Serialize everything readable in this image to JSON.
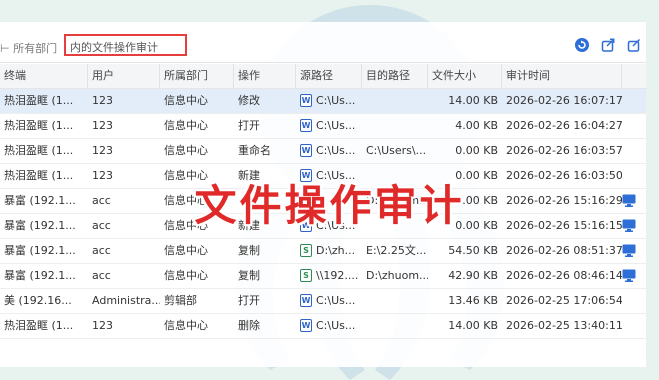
{
  "toolbar": {
    "breadcrumb": "⊢ 所有部门",
    "search_value": "内的文件操作审计",
    "refresh_icon": "refresh-icon",
    "export_icon": "export-icon",
    "share_icon": "share-icon"
  },
  "columns": [
    "终端",
    "用户",
    "所属部门",
    "操作",
    "源路径",
    "目的路径",
    "文件大小",
    "审计时间",
    ""
  ],
  "rows": [
    {
      "terminal": "热泪盈眶 (1...",
      "user": "123",
      "dept": "信息中心",
      "op": "修改",
      "src": "C:\\Us...",
      "dst": "",
      "size": "14.00 KB",
      "time": "2026-02-26 16:07:17",
      "icon": "word",
      "monitor": false,
      "selected": true
    },
    {
      "terminal": "热泪盈眶 (1...",
      "user": "123",
      "dept": "信息中心",
      "op": "打开",
      "src": "C:\\Us...",
      "dst": "",
      "size": "4.00 KB",
      "time": "2026-02-26 16:04:27",
      "icon": "word",
      "monitor": false,
      "selected": false
    },
    {
      "terminal": "热泪盈眶 (1...",
      "user": "123",
      "dept": "信息中心",
      "op": "重命名",
      "src": "C:\\Us...",
      "dst": "C:\\Users\\...",
      "size": "0.00 KB",
      "time": "2026-02-26 16:03:57",
      "icon": "word",
      "monitor": false,
      "selected": false
    },
    {
      "terminal": "热泪盈眶 (1...",
      "user": "123",
      "dept": "信息中心",
      "op": "新建",
      "src": "C:\\Us...",
      "dst": "",
      "size": "0.00 KB",
      "time": "2026-02-26 16:03:50",
      "icon": "word",
      "monitor": false,
      "selected": false
    },
    {
      "terminal": "暴富 (192.1...",
      "user": "acc",
      "dept": "信息中心",
      "op": "...",
      "src": "...",
      "dst": "D:\\zhuom...",
      "size": "...00 KB",
      "time": "2026-02-26 15:16:29",
      "icon": "word",
      "monitor": true,
      "selected": false
    },
    {
      "terminal": "暴富 (192.1...",
      "user": "acc",
      "dept": "信息中心",
      "op": "新建",
      "src": "C:\\Us...",
      "dst": "",
      "size": "0.00 KB",
      "time": "2026-02-26 15:16:15",
      "icon": "word",
      "monitor": true,
      "selected": false
    },
    {
      "terminal": "暴富 (192.1...",
      "user": "acc",
      "dept": "信息中心",
      "op": "复制",
      "src": "D:\\zh...",
      "dst": "E:\\2.25文...",
      "size": "54.50 KB",
      "time": "2026-02-26 08:51:37",
      "icon": "xls",
      "monitor": true,
      "selected": false
    },
    {
      "terminal": "暴富 (192.1...",
      "user": "acc",
      "dept": "信息中心",
      "op": "复制",
      "src": "\\\\192....",
      "dst": "D:\\zhuom...",
      "size": "42.90 KB",
      "time": "2026-02-26 08:46:14",
      "icon": "xls",
      "monitor": true,
      "selected": false
    },
    {
      "terminal": "美 (192.16...",
      "user": "Administra...",
      "dept": "剪辑部",
      "op": "打开",
      "src": "C:\\Us...",
      "dst": "",
      "size": "13.46 KB",
      "time": "2026-02-25 17:06:54",
      "icon": "word",
      "monitor": false,
      "selected": false
    },
    {
      "terminal": "热泪盈眶 (1...",
      "user": "123",
      "dept": "信息中心",
      "op": "删除",
      "src": "C:\\Us...",
      "dst": "",
      "size": "14.00 KB",
      "time": "2026-02-25 13:40:11",
      "icon": "word",
      "monitor": false,
      "selected": false
    }
  ],
  "overlay_title": "文件操作审计",
  "colors": {
    "accent": "#2d6fd6",
    "highlight_border": "#e63d3d",
    "overlay_text": "#e02a2a",
    "background": "#e8f3ef"
  }
}
